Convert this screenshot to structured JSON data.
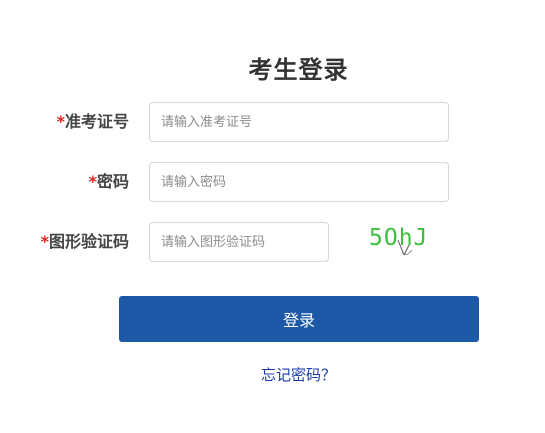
{
  "title": "考生登录",
  "fields": [
    {
      "required_mark": "*",
      "label": "准考证号",
      "placeholder": "请输入准考证号"
    },
    {
      "required_mark": "*",
      "label": "密码",
      "placeholder": "请输入密码"
    },
    {
      "required_mark": "*",
      "label": "图形验证码",
      "placeholder": "请输入图形验证码"
    }
  ],
  "captcha": {
    "text": "5OhJ",
    "color": "#3fbf3f"
  },
  "login_button": {
    "label": "登录",
    "color": "#1e59a8"
  },
  "forgot_link": "忘记密码？"
}
